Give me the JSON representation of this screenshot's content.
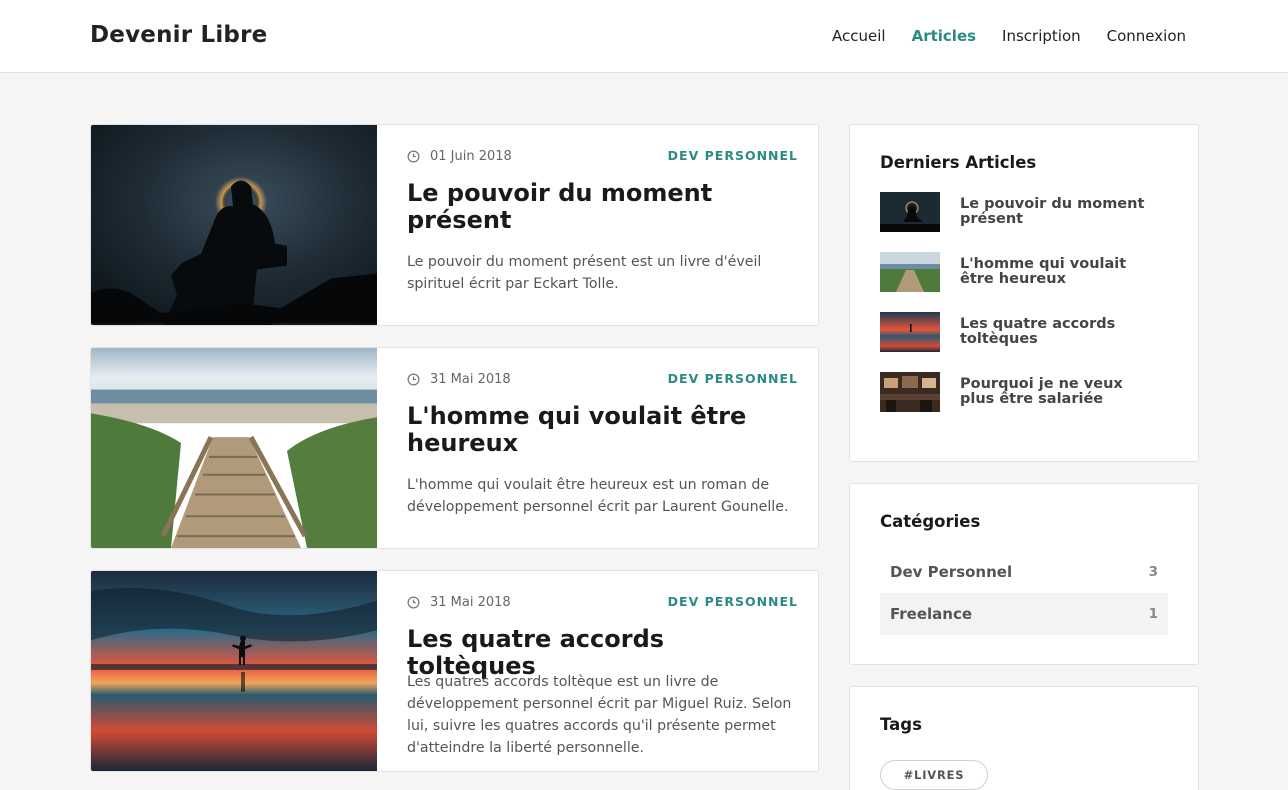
{
  "brand": "Devenir Libre",
  "nav": {
    "items": [
      {
        "label": "Accueil",
        "active": false
      },
      {
        "label": "Articles",
        "active": true
      },
      {
        "label": "Inscription",
        "active": false
      },
      {
        "label": "Connexion",
        "active": false
      }
    ]
  },
  "articles": [
    {
      "date": "01 Juin 2018",
      "category": "DEV PERSONNEL",
      "title": "Le pouvoir du moment présent",
      "excerpt": "Le pouvoir du moment présent est un livre d'éveil spirituel écrit par Eckart Tolle."
    },
    {
      "date": "31 Mai 2018",
      "category": "DEV PERSONNEL",
      "title": "L'homme qui voulait être heureux",
      "excerpt": "L'homme qui voulait être heureux est un roman de développement personnel écrit par Laurent Gounelle."
    },
    {
      "date": "31 Mai 2018",
      "category": "DEV PERSONNEL",
      "title": "Les quatre accords toltèques",
      "excerpt": "Les quatres accords toltèque est un livre de développement personnel écrit par Miguel Ruiz. Selon lui, suivre les quatres accords qu'il présente permet d'atteindre la liberté personnelle."
    }
  ],
  "sidebar": {
    "recent_heading": "Derniers Articles",
    "recent": [
      {
        "title": "Le pouvoir du moment présent"
      },
      {
        "title": "L'homme qui voulait être heureux"
      },
      {
        "title": "Les quatre accords toltèques"
      },
      {
        "title": "Pourquoi je ne veux plus être salariée"
      }
    ],
    "categories_heading": "Catégories",
    "categories": [
      {
        "name": "Dev Personnel",
        "count": "3"
      },
      {
        "name": "Freelance",
        "count": "1"
      }
    ],
    "tags_heading": "Tags",
    "tags": [
      {
        "label": "#LIVRES"
      }
    ]
  },
  "colors": {
    "accent": "#2a8a84",
    "background": "#f5f5f5",
    "card": "#ffffff"
  }
}
